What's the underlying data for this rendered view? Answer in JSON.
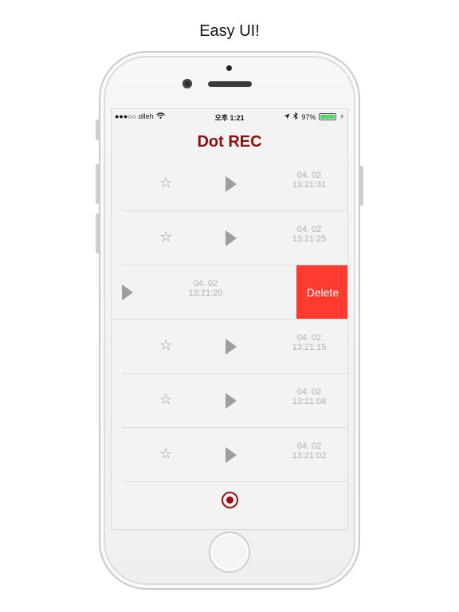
{
  "caption": "Easy UI!",
  "status_bar": {
    "carrier": "●●●○○ olleh",
    "time": "오후 1:21",
    "battery_text": "97%",
    "battery_level": 0.97
  },
  "app": {
    "title": "Dot REC",
    "title_color": "#8b1010"
  },
  "recordings": [
    {
      "date": "04. 02",
      "time": "13:21:31"
    },
    {
      "date": "04. 02",
      "time": "13:21:25"
    },
    {
      "date": "04. 02",
      "time": "13:21:20",
      "swiped": true
    },
    {
      "date": "04. 02",
      "time": "13:21:15"
    },
    {
      "date": "04. 02",
      "time": "13:21:08"
    },
    {
      "date": "04. 02",
      "time": "13:21:02"
    }
  ],
  "swipe_action": {
    "label": "Delete",
    "color": "#ff3b30"
  },
  "icons": {
    "favorite": "star-outline-icon",
    "play": "play-icon",
    "record": "record-icon",
    "wifi": "wifi-icon",
    "location": "location-arrow-icon",
    "bluetooth": "bluetooth-icon",
    "battery": "battery-icon"
  }
}
